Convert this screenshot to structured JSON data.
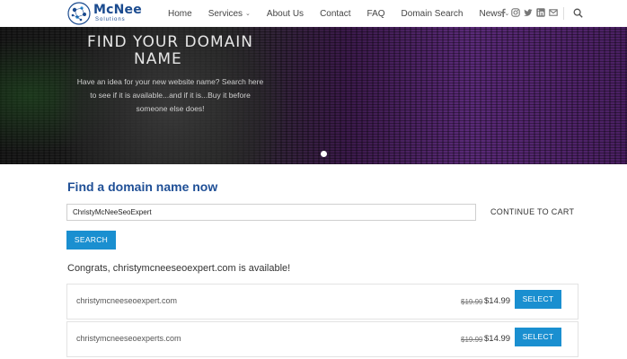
{
  "header": {
    "logo": {
      "word": "McNee",
      "sub": "Solutions"
    },
    "nav": [
      {
        "label": "Home",
        "dropdown": false
      },
      {
        "label": "Services",
        "dropdown": true
      },
      {
        "label": "About Us",
        "dropdown": false
      },
      {
        "label": "Contact",
        "dropdown": false
      },
      {
        "label": "FAQ",
        "dropdown": false
      },
      {
        "label": "Domain Search",
        "dropdown": false
      },
      {
        "label": "News",
        "dropdown": true
      }
    ],
    "socials": [
      "facebook-icon",
      "instagram-icon",
      "twitter-icon",
      "linkedin-icon",
      "email-icon"
    ],
    "search_icon": "search-icon"
  },
  "hero": {
    "title_line1": "FIND YOUR DOMAIN",
    "title_line2": "NAME",
    "subtitle": "Have an idea for your new website name? Search here to see if it is available...and if it is...Buy it before someone else does!",
    "slides": 1
  },
  "domain_search": {
    "heading": "Find a domain name now",
    "input_value": "ChristyMcNeeSeoExpert",
    "continue_label": "CONTINUE TO CART",
    "search_label": "SEARCH",
    "congrats": "Congrats, christymcneeseoexpert.com is available!",
    "results": [
      {
        "domain": "christymcneeseoexpert.com",
        "old_price": "$19.99",
        "price": "$14.99",
        "button": "SELECT"
      },
      {
        "domain": "christymcneeseoexperts.com",
        "old_price": "$19.99",
        "price": "$14.99",
        "button": "SELECT"
      }
    ]
  },
  "colors": {
    "brand_blue": "#1f4f96",
    "button_blue": "#1a8fd0"
  }
}
